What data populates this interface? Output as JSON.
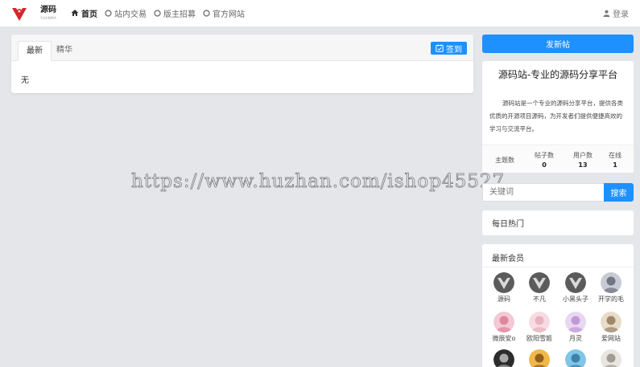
{
  "brand": {
    "logo_text": "源码",
    "logo_sub": "YUANMA"
  },
  "nav": [
    {
      "label": "首页",
      "icon": "home-icon",
      "active": true
    },
    {
      "label": "站内交易",
      "icon": "circle-icon",
      "active": false
    },
    {
      "label": "版主招募",
      "icon": "circle-icon",
      "active": false
    },
    {
      "label": "官方网站",
      "icon": "circle-icon",
      "active": false
    }
  ],
  "login_label": "登录",
  "main": {
    "tabs": [
      {
        "label": "最新",
        "active": true
      },
      {
        "label": "精华",
        "active": false
      }
    ],
    "signin_label": "签到",
    "empty_text": "无"
  },
  "watermark": "https://www.huzhan.com/ishop45527",
  "sidebar": {
    "post_button": "发新帖",
    "site_title": "源码站-专业的源码分享平台",
    "site_desc": "源码站是一个专业的源码分享平台，提供各类优质的开源项目源码，为开发者们提供便捷高效的学习与交流平台。",
    "stats": [
      {
        "label": "主题数",
        "value": ""
      },
      {
        "label": "帖子数",
        "value": "0"
      },
      {
        "label": "用户数",
        "value": "13"
      },
      {
        "label": "在线",
        "value": "1"
      }
    ],
    "search": {
      "placeholder": "关键词",
      "button": "搜索"
    },
    "hot_title": "每日热门",
    "members_title": "最新会员",
    "members": [
      {
        "name": "源码",
        "avatar": "default"
      },
      {
        "name": "不凡",
        "avatar": "default"
      },
      {
        "name": "小黑头子",
        "avatar": "default"
      },
      {
        "name": "开学的毛",
        "avatar": "photo"
      },
      {
        "name": "微辰安o",
        "avatar": "photo"
      },
      {
        "name": "欧阳雪姬",
        "avatar": "photo"
      },
      {
        "name": "月灵",
        "avatar": "photo"
      },
      {
        "name": "爱网站",
        "avatar": "photo"
      },
      {
        "name": "",
        "avatar": "photo"
      },
      {
        "name": "",
        "avatar": "photo"
      },
      {
        "name": "",
        "avatar": "photo"
      },
      {
        "name": "",
        "avatar": "photo"
      }
    ]
  },
  "colors": {
    "accent": "#1e90ff",
    "background": "#e4e6ea",
    "logo_red": "#d7262c"
  }
}
